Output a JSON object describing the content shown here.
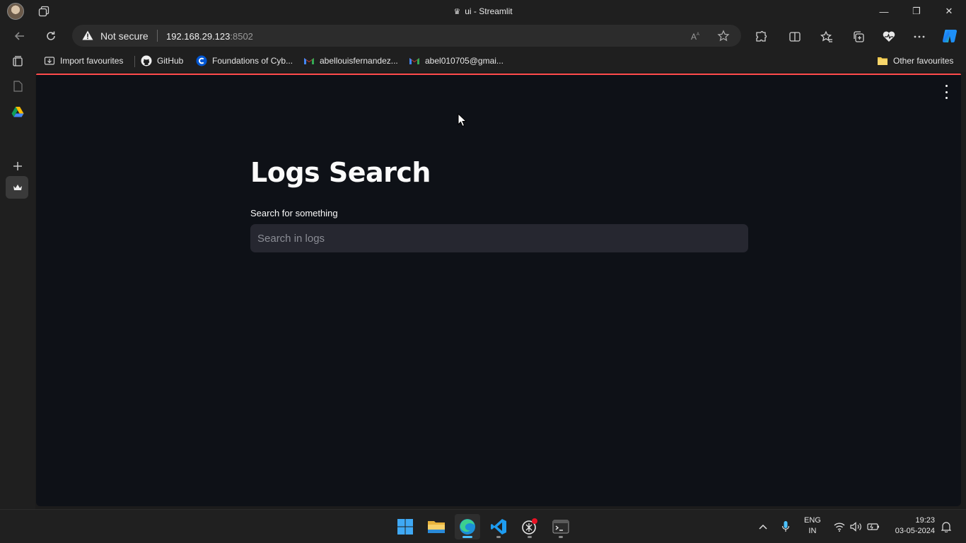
{
  "window": {
    "title": "ui - Streamlit",
    "minimize_glyph": "—",
    "restore_glyph": "❐",
    "close_glyph": "✕"
  },
  "address_bar": {
    "security_label": "Not secure",
    "url_host": "192.168.29.123",
    "url_port": ":8502"
  },
  "favourites": {
    "items": [
      {
        "label": "Import favourites",
        "icon": "import-icon"
      },
      {
        "label": "GitHub",
        "icon": "github-icon"
      },
      {
        "label": "Foundations of Cyb...",
        "icon": "coursera-icon"
      },
      {
        "label": "abellouisfernandez...",
        "icon": "gmail-icon"
      },
      {
        "label": "abel010705@gmai...",
        "icon": "gmail-icon"
      }
    ],
    "other_label": "Other favourites"
  },
  "app": {
    "title": "Logs Search",
    "search_label": "Search for something",
    "search_placeholder": "Search in logs",
    "search_value": ""
  },
  "taskbar": {
    "apps": [
      "start",
      "file-explorer",
      "edge",
      "vscode",
      "chatgpt",
      "terminal"
    ],
    "lang_top": "ENG",
    "lang_bottom": "IN",
    "time": "19:23",
    "date": "03-05-2024"
  },
  "colors": {
    "accent": "#ff4b4b",
    "app_bg": "#0e1117",
    "input_bg": "#262730",
    "browser_chrome": "#1f1f1f"
  }
}
